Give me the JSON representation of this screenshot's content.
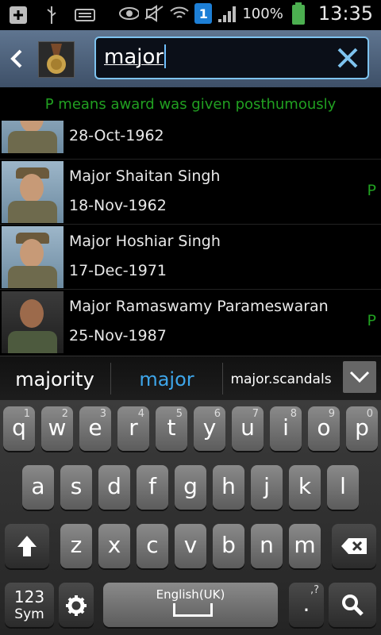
{
  "status": {
    "battery_pct": "100%",
    "time": "13:35",
    "sim_badge": "1"
  },
  "header": {
    "back_icon": "back-chevron-icon",
    "app_icon": "medal-icon",
    "search": {
      "value": "major"
    },
    "clear_icon": "clear-x-icon"
  },
  "notice": "P means award was given posthumously",
  "list": {
    "items": [
      {
        "name": "",
        "date": "28-Oct-1962",
        "flag": ""
      },
      {
        "name": "Major Shaitan Singh",
        "date": "18-Nov-1962",
        "flag": "P"
      },
      {
        "name": "Major Hoshiar Singh",
        "date": "17-Dec-1971",
        "flag": ""
      },
      {
        "name": "Major Ramaswamy Parameswaran",
        "date": "25-Nov-1987",
        "flag": "P"
      }
    ]
  },
  "suggestions": {
    "items": [
      "majority",
      "major",
      "major.scandals"
    ],
    "accent": "#3ea6ea"
  },
  "keyboard": {
    "row1": [
      {
        "k": "q",
        "n": "1"
      },
      {
        "k": "w",
        "n": "2"
      },
      {
        "k": "e",
        "n": "3"
      },
      {
        "k": "r",
        "n": "4"
      },
      {
        "k": "t",
        "n": "5"
      },
      {
        "k": "y",
        "n": "6"
      },
      {
        "k": "u",
        "n": "7"
      },
      {
        "k": "i",
        "n": "8"
      },
      {
        "k": "o",
        "n": "9"
      },
      {
        "k": "p",
        "n": "0"
      }
    ],
    "row2": [
      "a",
      "s",
      "d",
      "f",
      "g",
      "h",
      "j",
      "k",
      "l"
    ],
    "row3": [
      "z",
      "x",
      "c",
      "v",
      "b",
      "n",
      "m"
    ],
    "sym_top": "123",
    "sym_bottom": "Sym",
    "space_label": "English(UK)",
    "period": ".",
    "period_hint": ",?"
  }
}
